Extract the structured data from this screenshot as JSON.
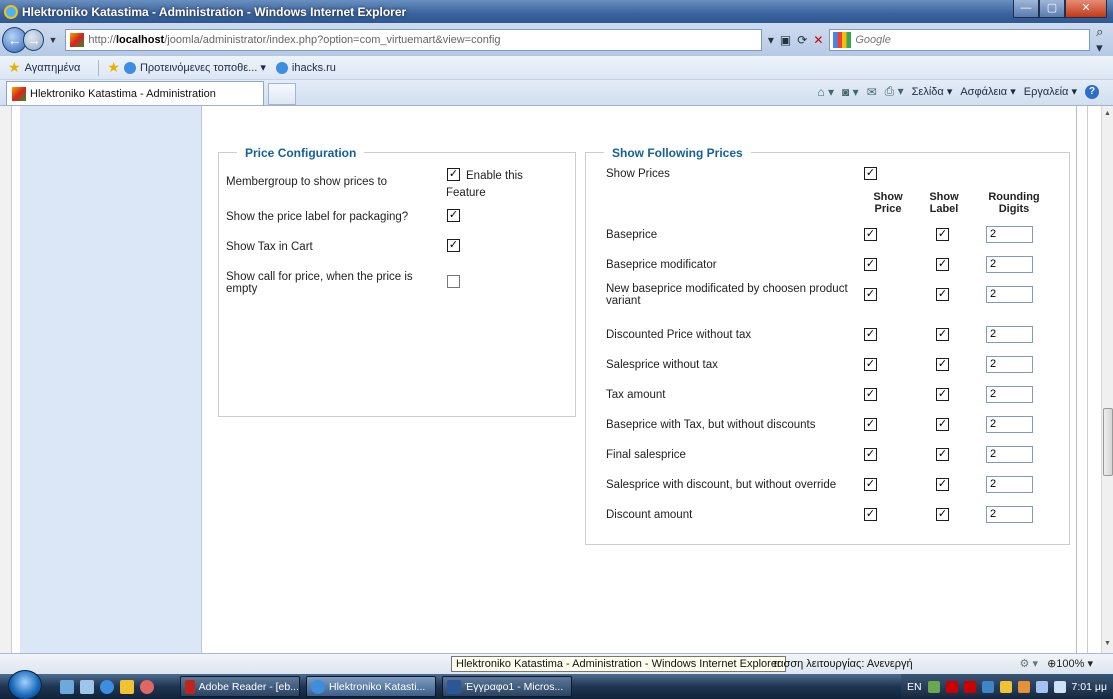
{
  "window": {
    "title": "Hlektroniko Katastima - Administration - Windows Internet Explorer",
    "min_label": "—",
    "max_label": "▢",
    "close_label": "✕"
  },
  "address": {
    "prefix": "http://",
    "host": "localhost",
    "path": "/joomla/administrator/index.php?option=com_virtuemart&view=config"
  },
  "search": {
    "placeholder": "Google"
  },
  "favorites": {
    "label": "Αγαπημένα",
    "suggested": "Προτεινόμενες τοποθε...",
    "site": "ihacks.ru"
  },
  "tabs": [
    {
      "label": "Hlektroniko Katastima - Administration"
    }
  ],
  "commandbar": {
    "page": "Σελίδα",
    "safety": "Ασφάλεια",
    "tools": "Εργαλεία"
  },
  "price_config": {
    "legend": "Price Configuration",
    "rows": [
      {
        "label": "Membergroup to show prices to",
        "checked": true,
        "extra": "Enable this",
        "extra2": "Feature"
      },
      {
        "label": "Show the price label for packaging?",
        "checked": true
      },
      {
        "label": "Show Tax in Cart",
        "checked": true
      },
      {
        "label": "Show call for price, when the price is",
        "label2": "empty",
        "checked": false
      }
    ]
  },
  "show_prices": {
    "legend": "Show Following Prices",
    "show_prices_label": "Show Prices",
    "show_prices_checked": true,
    "headers": {
      "show_price": [
        "Show",
        "Price"
      ],
      "show_label": [
        "Show",
        "Label"
      ],
      "rounding": [
        "Rounding",
        "Digits"
      ]
    },
    "rows": [
      {
        "label": "Baseprice",
        "show_price": true,
        "show_label": true,
        "digits": "2"
      },
      {
        "label": "Baseprice modificator",
        "show_price": true,
        "show_label": true,
        "digits": "2"
      },
      {
        "label": "New baseprice modificated by choosen product",
        "label2": "variant",
        "show_price": true,
        "show_label": true,
        "digits": "2"
      },
      {
        "label": "Discounted Price without tax",
        "show_price": true,
        "show_label": true,
        "digits": "2"
      },
      {
        "label": "Salesprice without tax",
        "show_price": true,
        "show_label": true,
        "digits": "2"
      },
      {
        "label": "Tax amount",
        "show_price": true,
        "show_label": true,
        "digits": "2"
      },
      {
        "label": "Baseprice with Tax, but without discounts",
        "show_price": true,
        "show_label": true,
        "digits": "2"
      },
      {
        "label": "Final salesprice",
        "show_price": true,
        "show_label": true,
        "digits": "2"
      },
      {
        "label": "Salesprice with discount, but without override",
        "show_price": true,
        "show_label": true,
        "digits": "2"
      },
      {
        "label": "Discount amount",
        "show_price": true,
        "show_label": true,
        "digits": "2"
      }
    ]
  },
  "status": {
    "tooltip": "Hlektroniko Katastima - Administration - Windows Internet Explorer",
    "text": "τασση λειτουργίας: Ανενεργή",
    "zoom": "100%"
  },
  "taskbar": {
    "items": [
      {
        "label": "Adobe Reader - [eb...",
        "color": "#c0241a"
      },
      {
        "label": "Hlektroniko Katasti...",
        "color": "#3d8ee0",
        "active": true
      },
      {
        "label": "Έγγραφο1 - Micros...",
        "color": "#2b5797"
      }
    ],
    "lang": "EN",
    "time": "7:01 μμ"
  }
}
